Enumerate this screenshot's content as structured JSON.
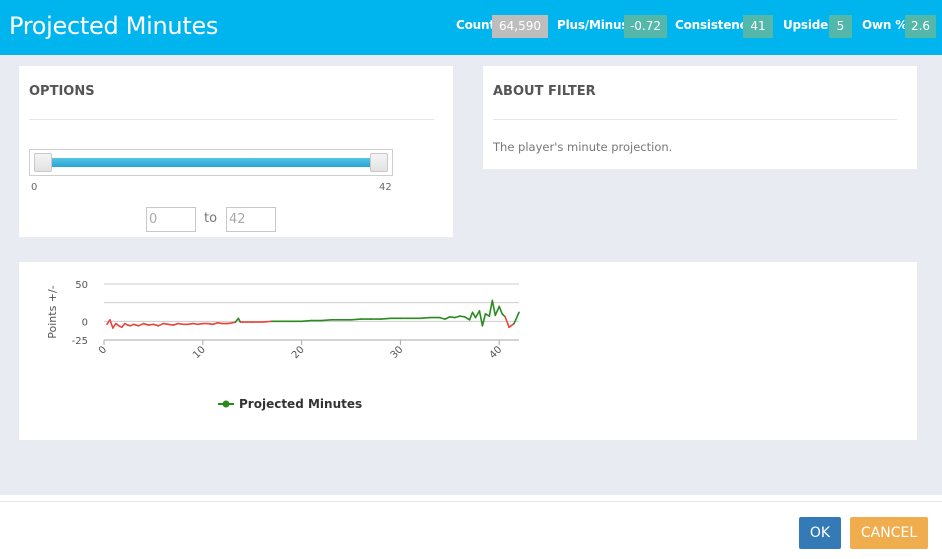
{
  "header": {
    "title": "Projected Minutes",
    "stats": [
      {
        "label": "Count",
        "value": "64,590",
        "color": "#bdbdbd"
      },
      {
        "label": "Plus/Minus",
        "value": "-0.72",
        "color": "#53b7a9"
      },
      {
        "label": "Consistency",
        "value": "41",
        "color": "#53b7a9"
      },
      {
        "label": "Upside:",
        "value": "5",
        "color": "#53b7a9"
      },
      {
        "label": "Own %",
        "value": "2.6",
        "color": "#53b7a9"
      }
    ]
  },
  "options": {
    "title": "OPTIONS",
    "slider": {
      "min_label": "0",
      "max_label": "42",
      "low": 0,
      "high": 42
    },
    "from_value": "0",
    "to_label": "to",
    "to_value": "42"
  },
  "about": {
    "title": "ABOUT FILTER",
    "text": "The player's minute projection."
  },
  "chart_data": {
    "type": "line",
    "ylabel": "Points +/-",
    "y_ticks": [
      "50",
      "0",
      "-25"
    ],
    "x_ticks": [
      "0",
      "10",
      "20",
      "30",
      "40"
    ],
    "ylim": [
      -25,
      50
    ],
    "xlim": [
      0,
      42
    ],
    "legend": "Projected Minutes",
    "legend_position": "bottom",
    "series": [
      {
        "name": "Projected Minutes",
        "color": "#2a8a1f",
        "negative_color": "#e8463c",
        "x": [
          0.3,
          0.6,
          0.9,
          1.2,
          1.5,
          1.8,
          2.1,
          2.4,
          2.7,
          3,
          3.5,
          4,
          4.5,
          5,
          5.5,
          6,
          6.5,
          7,
          7.5,
          8,
          8.5,
          9,
          9.5,
          10,
          10.5,
          11,
          11.5,
          12,
          12.5,
          13,
          13.3,
          13.6,
          13.8,
          14,
          14.5,
          15,
          16,
          17,
          18,
          19,
          20,
          21,
          22,
          23,
          24,
          25,
          26,
          27,
          28,
          29,
          30,
          31,
          32,
          33,
          34,
          34.5,
          35,
          35.5,
          36,
          36.5,
          37,
          37.3,
          37.6,
          38,
          38.3,
          38.6,
          39,
          39.3,
          39.6,
          40,
          40.3,
          40.6,
          41,
          41.5,
          42
        ],
        "values": [
          -4,
          2,
          -9,
          -3,
          -6,
          -8,
          -3,
          -5,
          -6,
          -4,
          -6,
          -3,
          -5,
          -4,
          -6,
          -3,
          -4,
          -5,
          -3,
          -4,
          -4,
          -3,
          -4,
          -3,
          -3,
          -4,
          -2,
          -3,
          -3,
          -2,
          -1,
          4,
          -1,
          -1,
          -1,
          -1,
          -1,
          0,
          0,
          0,
          0,
          1,
          1,
          2,
          2,
          2,
          3,
          3,
          3,
          4,
          4,
          4,
          4,
          5,
          5,
          3,
          6,
          5,
          7,
          6,
          2,
          12,
          5,
          14,
          -6,
          10,
          7,
          28,
          8,
          20,
          10,
          6,
          -8,
          -3,
          12
        ]
      }
    ]
  },
  "footer": {
    "ok_label": "OK",
    "cancel_label": "CANCEL",
    "ok_color": "#337ab7",
    "cancel_color": "#f0ad4e"
  }
}
